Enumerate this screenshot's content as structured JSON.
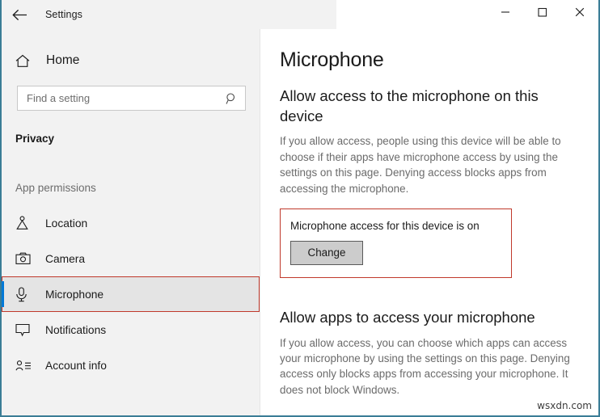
{
  "window": {
    "title": "Settings",
    "back_icon": "back-arrow-icon",
    "controls": {
      "minimize": "—",
      "maximize": "□",
      "close": "✕"
    },
    "border_color": "#3a7d96"
  },
  "sidebar": {
    "home": {
      "label": "Home",
      "icon": "home-icon"
    },
    "search": {
      "placeholder": "Find a setting",
      "value": "",
      "icon": "search-icon"
    },
    "section_title": "Privacy",
    "group_label": "App permissions",
    "items": [
      {
        "label": "Location",
        "icon": "location-icon",
        "selected": false,
        "highlighted": false
      },
      {
        "label": "Camera",
        "icon": "camera-icon",
        "selected": false,
        "highlighted": false
      },
      {
        "label": "Microphone",
        "icon": "microphone-icon",
        "selected": true,
        "highlighted": true
      },
      {
        "label": "Notifications",
        "icon": "notification-icon",
        "selected": false,
        "highlighted": false
      },
      {
        "label": "Account info",
        "icon": "account-info-icon",
        "selected": false,
        "highlighted": false
      }
    ],
    "accent_color": "#0078d7",
    "background_color": "#f2f2f2"
  },
  "main": {
    "page_title": "Microphone",
    "section_device": {
      "heading": "Allow access to the microphone on this device",
      "description": "If you allow access, people using this device will be able to choose if their apps have microphone access by using the settings on this page. Denying access blocks apps from accessing the microphone.",
      "status_text": "Microphone access for this device is on",
      "change_label": "Change",
      "highlight_color": "#c0392b"
    },
    "section_apps": {
      "heading": "Allow apps to access your microphone",
      "description": "If you allow access, you can choose which apps can access your microphone by using the settings on this page. Denying access only blocks apps from accessing your microphone. It does not block Windows."
    }
  },
  "watermark": {
    "text": "wsxdn.com"
  }
}
